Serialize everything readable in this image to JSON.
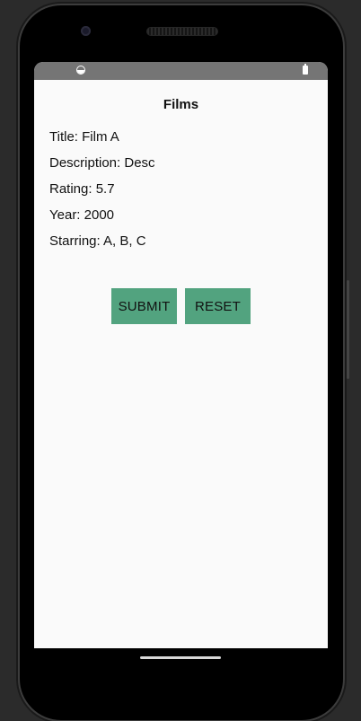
{
  "status_bar": {
    "left_icon": "data-saver-icon",
    "right_icon": "battery-icon"
  },
  "app": {
    "title": "Films"
  },
  "film": {
    "title": "Title: Film A",
    "description": "Description: Desc",
    "rating": "Rating: 5.7",
    "year": "Year: 2000",
    "starring": "Starring: A, B, C"
  },
  "actions": {
    "submit_label": "SUBMIT",
    "reset_label": "RESET"
  },
  "colors": {
    "button": "#52a37f",
    "status_bar": "#757575",
    "background": "#fafafa"
  }
}
